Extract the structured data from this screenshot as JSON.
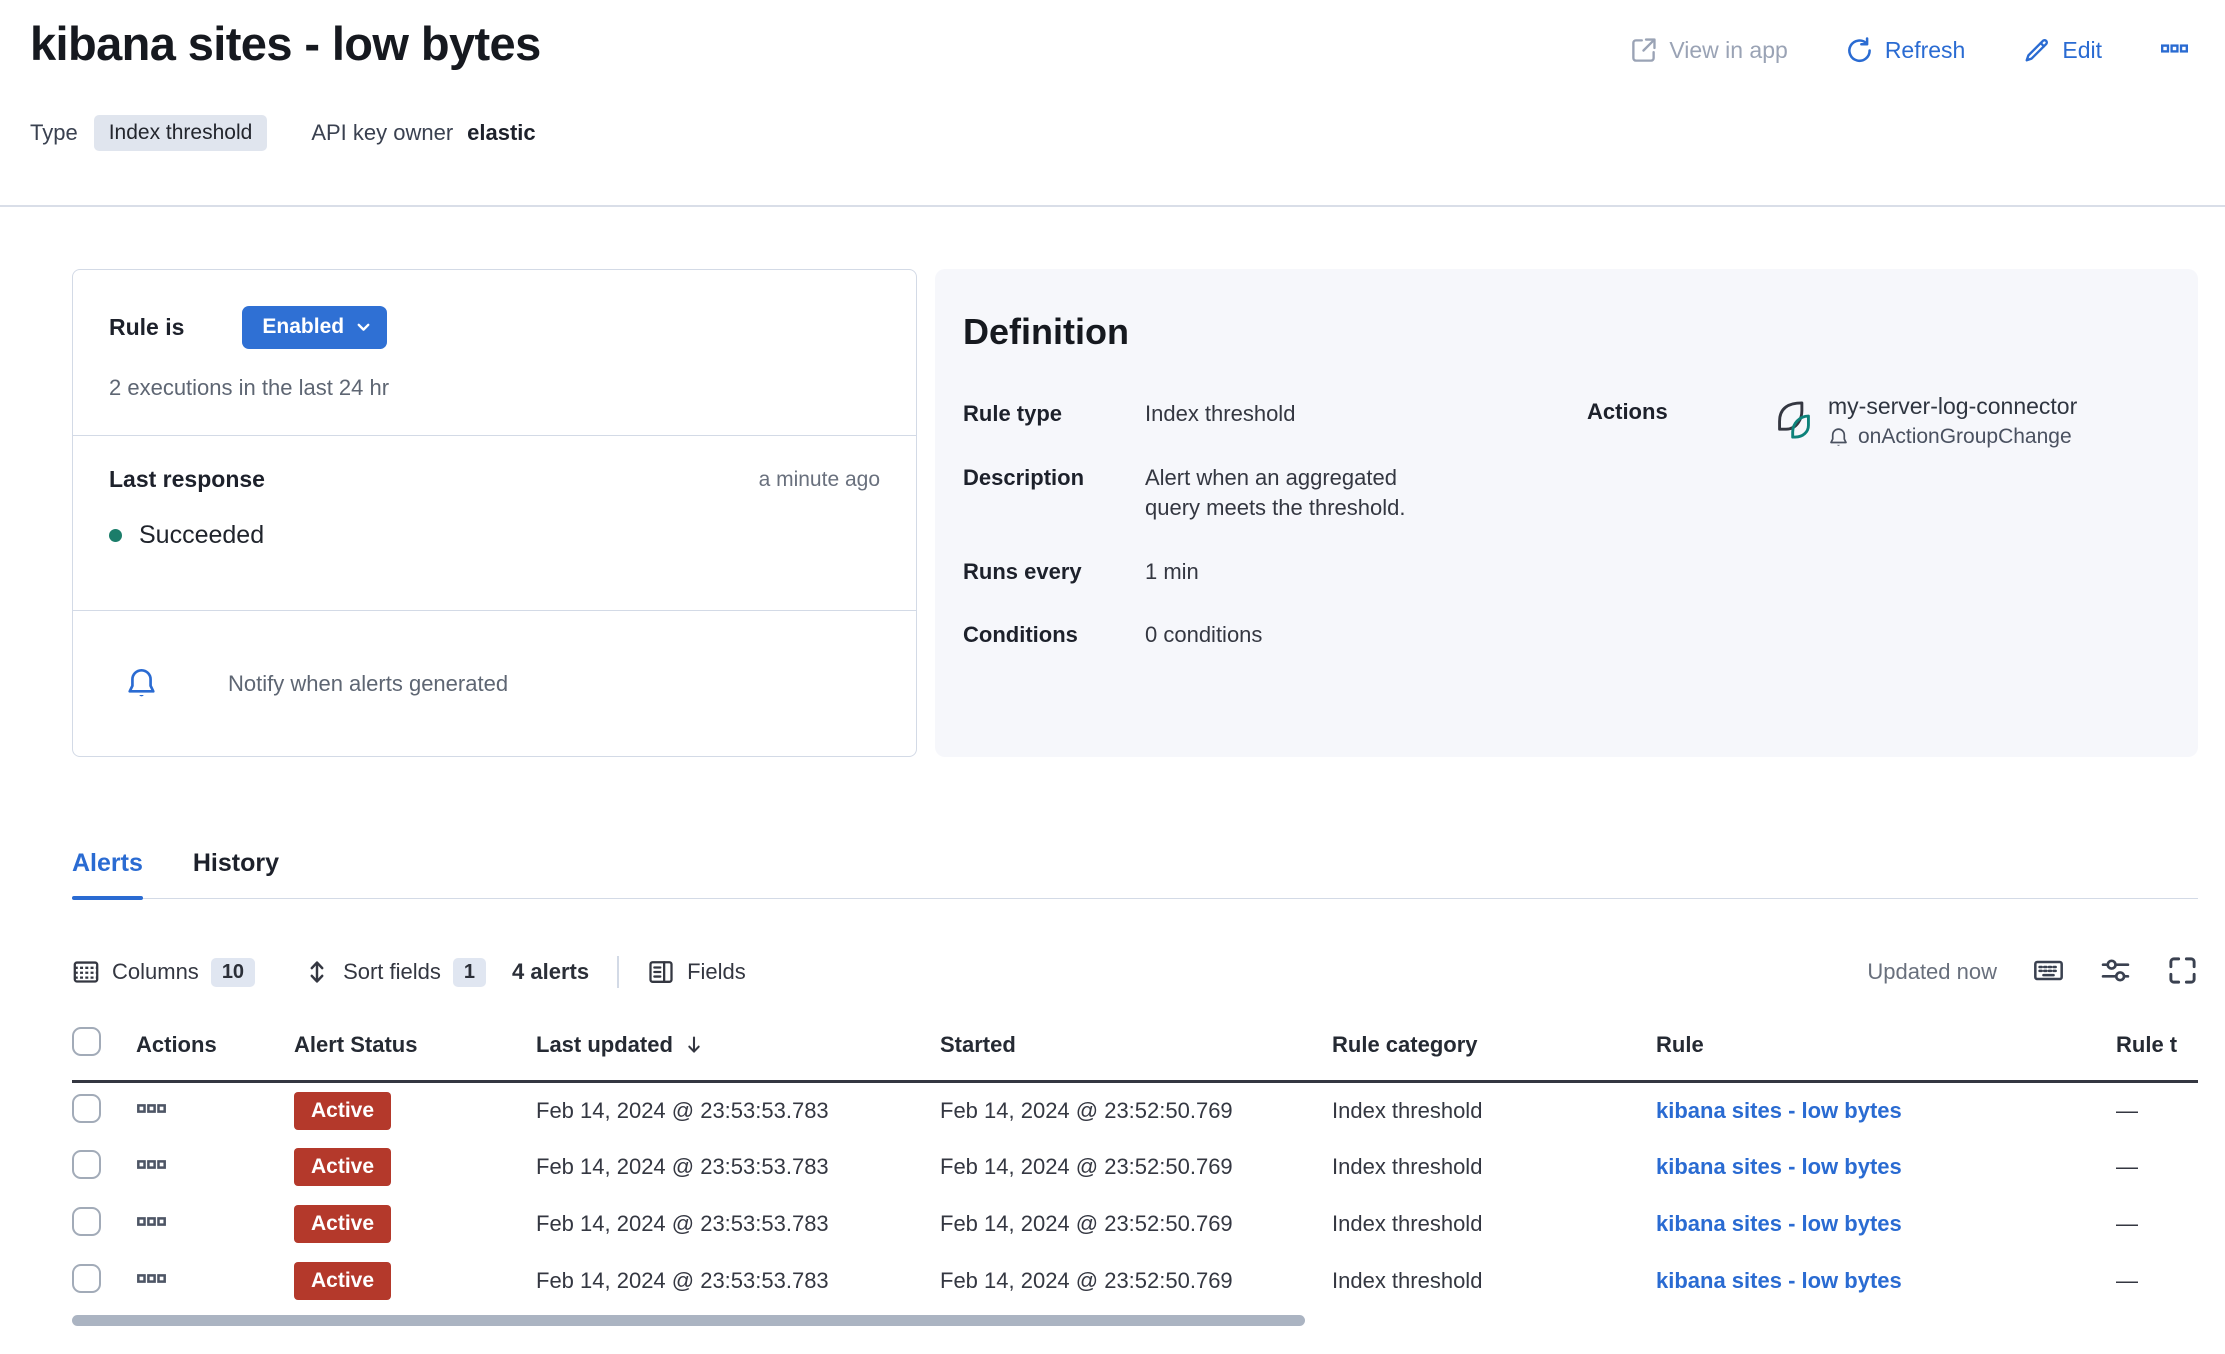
{
  "page": {
    "title": "kibana sites - low bytes",
    "type_label": "Type",
    "type_badge": "Index threshold",
    "api_key_owner_label": "API key owner",
    "api_key_owner_value": "elastic"
  },
  "header_actions": {
    "view_in_app": "View in app",
    "refresh": "Refresh",
    "edit": "Edit",
    "more_menu_icon": "boxes-horizontal-icon"
  },
  "status_card": {
    "rule_is_label": "Rule is",
    "enabled_button": "Enabled",
    "executions_text": "2 executions in the last 24 hr",
    "last_response_label": "Last response",
    "last_response_time": "a minute ago",
    "last_response_status": "Succeeded",
    "notify_text": "Notify when alerts generated"
  },
  "definition": {
    "heading": "Definition",
    "rule_type_label": "Rule type",
    "rule_type_value": "Index threshold",
    "description_label": "Description",
    "description_value": "Alert when an aggregated\nquery meets the threshold.",
    "runs_every_label": "Runs every",
    "runs_every_value": "1 min",
    "conditions_label": "Conditions",
    "conditions_value": "0 conditions",
    "actions_label": "Actions",
    "connector_name": "my-server-log-connector",
    "connector_trigger": "onActionGroupChange"
  },
  "tabs": [
    {
      "label": "Alerts",
      "active": true
    },
    {
      "label": "History",
      "active": false
    }
  ],
  "table_toolbar": {
    "columns_label": "Columns",
    "columns_count": "10",
    "sort_label": "Sort fields",
    "sort_count": "1",
    "alerts_count": "4 alerts",
    "fields_label": "Fields",
    "updated_text": "Updated now"
  },
  "alerts_table": {
    "headers": [
      "Actions",
      "Alert Status",
      "Last updated",
      "Started",
      "Rule category",
      "Rule",
      "Rule t"
    ],
    "sorted_column": "Last updated",
    "sort_direction": "descending",
    "rows": [
      {
        "status": "Active",
        "last_updated": "Feb 14, 2024 @ 23:53:53.783",
        "started": "Feb 14, 2024 @ 23:52:50.769",
        "rule_category": "Index threshold",
        "rule": "kibana sites - low bytes",
        "rule_tags": "—"
      },
      {
        "status": "Active",
        "last_updated": "Feb 14, 2024 @ 23:53:53.783",
        "started": "Feb 14, 2024 @ 23:52:50.769",
        "rule_category": "Index threshold",
        "rule": "kibana sites - low bytes",
        "rule_tags": "—"
      },
      {
        "status": "Active",
        "last_updated": "Feb 14, 2024 @ 23:53:53.783",
        "started": "Feb 14, 2024 @ 23:52:50.769",
        "rule_category": "Index threshold",
        "rule": "kibana sites - low bytes",
        "rule_tags": "—"
      },
      {
        "status": "Active",
        "last_updated": "Feb 14, 2024 @ 23:53:53.783",
        "started": "Feb 14, 2024 @ 23:52:50.769",
        "rule_category": "Index threshold",
        "rule": "kibana sites - low bytes",
        "rule_tags": "—"
      }
    ]
  },
  "colors": {
    "primary_blue": "#2a6bd2",
    "danger_badge": "#b4392b",
    "success_dot": "#1b7d6a",
    "panel_background": "#f6f7fb",
    "badge_background": "#e0e5ee",
    "border": "#d3dae6"
  },
  "icons": {
    "view_in_app": "external-link-icon",
    "refresh": "refresh-icon",
    "edit": "pencil-icon",
    "notify": "bell-icon",
    "connector": "logs-connector-icon",
    "columns": "table-icon",
    "sort": "sortable-icon",
    "fields": "fields-panel-icon",
    "keyboard": "keyboard-icon",
    "display_options": "sliders-icon",
    "fullscreen": "fullscreen-icon"
  }
}
